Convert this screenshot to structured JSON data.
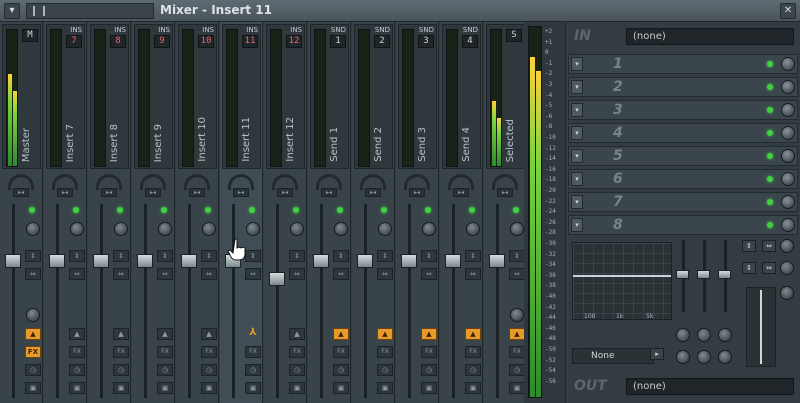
{
  "window": {
    "title": "Mixer - Insert 11"
  },
  "strips": [
    {
      "name": "Master",
      "tag": "",
      "slot": "",
      "m1": 0.68,
      "m2": 0.55,
      "fader": 0.72,
      "selected": false,
      "special": "master"
    },
    {
      "name": "Insert 7",
      "tag": "INS",
      "slot": "7",
      "m1": 0.0,
      "m2": 0.0,
      "fader": 0.72,
      "selected": false
    },
    {
      "name": "Insert 8",
      "tag": "INS",
      "slot": "8",
      "m1": 0.0,
      "m2": 0.0,
      "fader": 0.72,
      "selected": false
    },
    {
      "name": "Insert 9",
      "tag": "INS",
      "slot": "9",
      "m1": 0.0,
      "m2": 0.0,
      "fader": 0.72,
      "selected": false
    },
    {
      "name": "Insert 10",
      "tag": "INS",
      "slot": "10",
      "m1": 0.0,
      "m2": 0.0,
      "fader": 0.72,
      "selected": false
    },
    {
      "name": "Insert 11",
      "tag": "INS",
      "slot": "11",
      "m1": 0.0,
      "m2": 0.0,
      "fader": 0.72,
      "selected": true
    },
    {
      "name": "Insert 12",
      "tag": "INS",
      "slot": "12",
      "m1": 0.0,
      "m2": 0.0,
      "fader": 0.62,
      "selected": false
    },
    {
      "name": "Send 1",
      "tag": "SND",
      "slot": "1",
      "m1": 0.0,
      "m2": 0.0,
      "fader": 0.72,
      "selected": false
    },
    {
      "name": "Send 2",
      "tag": "SND",
      "slot": "2",
      "m1": 0.0,
      "m2": 0.0,
      "fader": 0.72,
      "selected": false
    },
    {
      "name": "Send 3",
      "tag": "SND",
      "slot": "3",
      "m1": 0.0,
      "m2": 0.0,
      "fader": 0.72,
      "selected": false
    },
    {
      "name": "Send 4",
      "tag": "SND",
      "slot": "4",
      "m1": 0.0,
      "m2": 0.0,
      "fader": 0.72,
      "selected": false
    },
    {
      "name": "Selected",
      "tag": "",
      "slot": "",
      "m1": 0.48,
      "m2": 0.35,
      "fader": 0.72,
      "selected": false,
      "special": "selected"
    }
  ],
  "strip_buttons": {
    "fx": "FX"
  },
  "master_meter": {
    "scale": [
      "+2",
      "+1",
      "0",
      "-1",
      "-2",
      "-3",
      "-4",
      "-5",
      "-6",
      "-8",
      "-10",
      "-12",
      "-14",
      "-16",
      "-18",
      "-20",
      "-22",
      "-24",
      "-26",
      "-28",
      "-30",
      "-32",
      "-34",
      "-36",
      "-38",
      "-40",
      "-42",
      "-44",
      "-46",
      "-48",
      "-50",
      "-52",
      "-54",
      "-56"
    ],
    "left": 0.92,
    "right": 0.88
  },
  "fx_panel": {
    "in_label": "IN",
    "in_value": "(none)",
    "slots": [
      "1",
      "2",
      "3",
      "4",
      "5",
      "6",
      "7",
      "8"
    ],
    "eq_labels": [
      "100",
      "1k",
      "5k"
    ],
    "preset": "None",
    "out_label": "OUT",
    "out_value": "(none)"
  },
  "colors": {
    "meter_green": "#2d8a2d",
    "meter_yellow": "#ffd23a",
    "accent_orange": "#e79a2b",
    "led_green": "#41d241"
  }
}
